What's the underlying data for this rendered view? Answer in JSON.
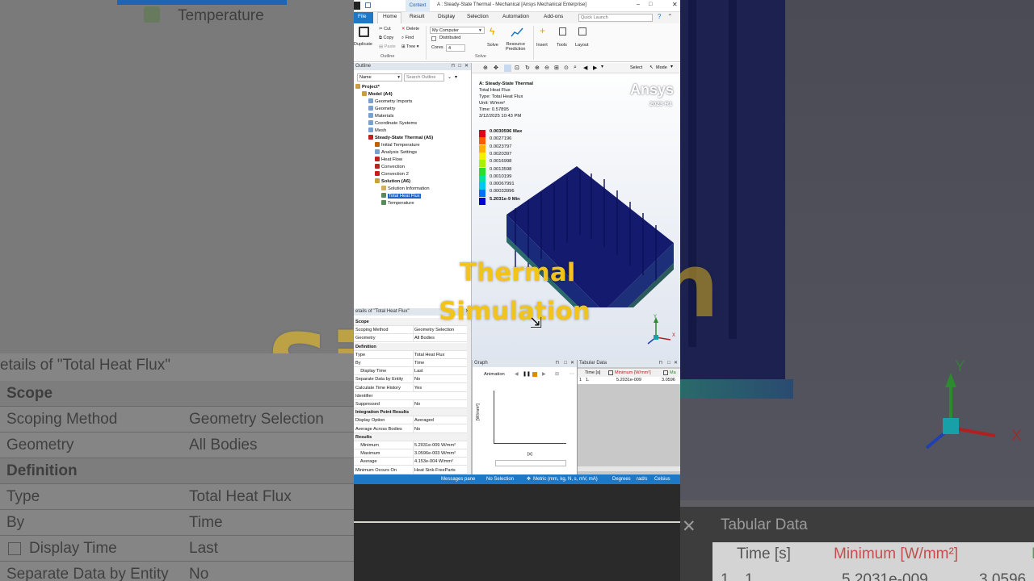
{
  "background": {
    "left_texts": {
      "temperature": "Temperature",
      "details_title": "etails of \"Total Heat Flux\"",
      "scope": "Scope",
      "scoping_method": "Scoping Method",
      "scoping_method_value": "Geometry Selection",
      "geometry": "Geometry",
      "geometry_value": "All Bodies",
      "definition": "Definition",
      "type": "Type",
      "type_value": "Total Heat Flux",
      "by": "By",
      "by_value": "Time",
      "display_time": "Display Time",
      "display_time_value": "Last",
      "separate": "Separate Data by Entity",
      "separate_value": "No"
    },
    "left_big_text": "Si",
    "right_texts": {
      "tabular_title": "Tabular Data",
      "time_col": "Time [s]",
      "min_col": "Minimum [W/mm²]",
      "max_col": "Ma",
      "row_num": "1",
      "row_time": "1.",
      "row_min": "5.2031e-009",
      "row_max": "3.0596",
      "axis_y": "Y",
      "axis_x": "X"
    }
  },
  "titlebar": {
    "context_tab": "Context",
    "title": "A : Steady-State Thermal - Mechanical [Ansys Mechanical Enterprise]"
  },
  "ribbon_tabs": [
    "File",
    "Home",
    "Result",
    "Display",
    "Selection",
    "Automation",
    "Add-ons"
  ],
  "quick_launch_placeholder": "Quick Launch",
  "ribbon": {
    "duplicate": "Duplicate",
    "cut": "Cut",
    "copy": "Copy",
    "paste": "Paste",
    "delete": "Delete",
    "find": "Find",
    "tree": "Tree",
    "outline_group": "Outline",
    "my_computer": "My Computer",
    "distributed": "Distributed",
    "cores_label": "Cores",
    "cores_value": "4",
    "solve": "Solve",
    "resource": "Resource",
    "prediction": "Prediction",
    "solve_group": "Solve",
    "insert": "Insert",
    "tools": "Tools",
    "layout": "Layout"
  },
  "outline": {
    "title": "Outline",
    "name_filter": "Name",
    "search_placeholder": "Search Outline",
    "items": [
      {
        "label": "Project*",
        "bold": true
      },
      {
        "label": "Model (A4)",
        "bold": true
      },
      {
        "label": "Geometry Imports",
        "bold": false
      },
      {
        "label": "Geometry",
        "bold": false
      },
      {
        "label": "Materials",
        "bold": false
      },
      {
        "label": "Coordinate Systems",
        "bold": false
      },
      {
        "label": "Mesh",
        "bold": false
      },
      {
        "label": "Steady-State Thermal (A5)",
        "bold": true
      },
      {
        "label": "Initial Temperature",
        "bold": false
      },
      {
        "label": "Analysis Settings",
        "bold": false
      },
      {
        "label": "Heat Flow",
        "bold": false
      },
      {
        "label": "Convection",
        "bold": false
      },
      {
        "label": "Convection 2",
        "bold": false
      },
      {
        "label": "Solution (A6)",
        "bold": true
      },
      {
        "label": "Solution Information",
        "bold": false
      },
      {
        "label": "Total Heat Flux",
        "bold": false
      },
      {
        "label": "Temperature",
        "bold": false
      }
    ]
  },
  "viewport": {
    "toolbar_select": "Select",
    "toolbar_mode": "Mode",
    "info": {
      "title": "A: Steady-State Thermal",
      "result": "Total Heat Flux",
      "type": "Type: Total Heat Flux",
      "unit": "Unit: W/mm²",
      "time": "Time: 0.57895",
      "date": "3/12/2025 10:43 PM"
    },
    "brand": "Ansys",
    "version": "2023 R1",
    "legend": [
      {
        "value": "0.0030596 Max",
        "color": "#e0001a",
        "bold": true
      },
      {
        "value": "0.0027196",
        "color": "#ff5a00",
        "bold": false
      },
      {
        "value": "0.0023797",
        "color": "#ffb000",
        "bold": false
      },
      {
        "value": "0.0020397",
        "color": "#f4f000",
        "bold": false
      },
      {
        "value": "0.0016998",
        "color": "#a8f000",
        "bold": false
      },
      {
        "value": "0.0013598",
        "color": "#28e028",
        "bold": false
      },
      {
        "value": "0.0010199",
        "color": "#00e0a0",
        "bold": false
      },
      {
        "value": "0.00067991",
        "color": "#00c8f0",
        "bold": false
      },
      {
        "value": "0.00033996",
        "color": "#0070ff",
        "bold": false
      },
      {
        "value": "5.2031e-9 Min",
        "color": "#0000d8",
        "bold": true
      }
    ],
    "axis_y": "Y",
    "axis_x": "X",
    "axis_z": "Z"
  },
  "overlay": {
    "line1": "Thermal",
    "line2": "Simulation"
  },
  "details": {
    "title": "etails of \"Total Heat Flux\"",
    "rows": [
      {
        "k": "Scope",
        "v": "",
        "section": true
      },
      {
        "k": "Scoping Method",
        "v": "Geometry Selection",
        "section": false
      },
      {
        "k": "Geometry",
        "v": "All Bodies",
        "section": false
      },
      {
        "k": "Definition",
        "v": "",
        "section": true
      },
      {
        "k": "Type",
        "v": "Total Heat Flux",
        "section": false
      },
      {
        "k": "By",
        "v": "Time",
        "section": false
      },
      {
        "k": "    Display Time",
        "v": "Last",
        "section": false
      },
      {
        "k": "Separate Data by Entity",
        "v": "No",
        "section": false
      },
      {
        "k": "Calculate Time History",
        "v": "Yes",
        "section": false
      },
      {
        "k": "Identifier",
        "v": "",
        "section": false
      },
      {
        "k": "Suppressed",
        "v": "No",
        "section": false
      },
      {
        "k": "Integration Point Results",
        "v": "",
        "section": true
      },
      {
        "k": "Display Option",
        "v": "Averaged",
        "section": false
      },
      {
        "k": "Average Across Bodies",
        "v": "No",
        "section": false
      },
      {
        "k": "Results",
        "v": "",
        "section": true
      },
      {
        "k": "    Minimum",
        "v": "5.2031e-009 W/mm²",
        "section": false
      },
      {
        "k": "    Maximum",
        "v": "3.0596e-003 W/mm²",
        "section": false
      },
      {
        "k": "    Average",
        "v": "4.153e-004 W/mm²",
        "section": false
      },
      {
        "k": "Minimum Occurs On",
        "v": "Heat Sink-FreeParts",
        "section": false
      }
    ]
  },
  "graph": {
    "title": "Graph",
    "animation": "Animation",
    "ylabel": "[W/mm²]",
    "xlabel": "[s]"
  },
  "tabular": {
    "title": "Tabular Data",
    "col_time": "Time [s]",
    "col_min": "Minimum [W/mm²]",
    "col_max": "Ma",
    "row_num": "1",
    "row_time": "1.",
    "row_min": "5.2031e-009",
    "row_max": "3.0596"
  },
  "status": {
    "messages": "Messages pane",
    "selection": "No Selection",
    "units": "Metric (mm, kg, N, s, mV, mA)",
    "angle": "Degrees",
    "rate": "rad/s",
    "temp": "Celsius"
  }
}
